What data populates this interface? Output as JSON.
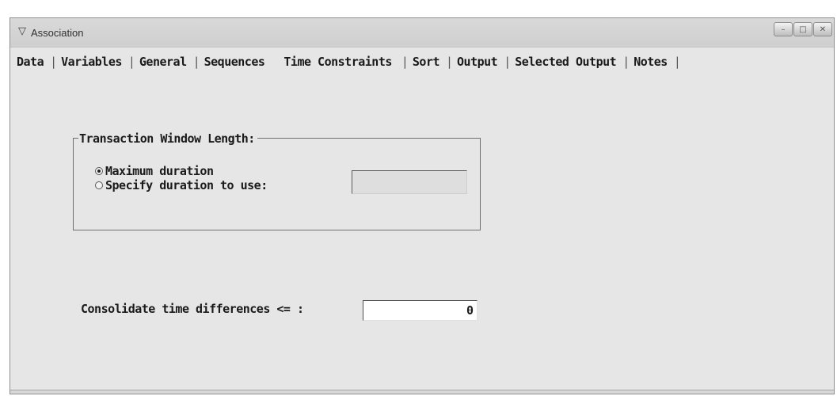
{
  "window": {
    "title": "Association",
    "icon": "sas-v-icon",
    "controls": {
      "minimize": "–",
      "maximize": "□",
      "close": "✕"
    }
  },
  "tabs": [
    {
      "label": "Data"
    },
    {
      "label": "Variables"
    },
    {
      "label": "General"
    },
    {
      "label": "Sequences"
    },
    {
      "label": "Time Constraints",
      "active": true
    },
    {
      "label": "Sort"
    },
    {
      "label": "Output"
    },
    {
      "label": "Selected Output"
    },
    {
      "label": "Notes"
    }
  ],
  "transaction_window": {
    "legend": "Transaction Window Length:",
    "options": [
      {
        "label": "Maximum duration",
        "checked": true
      },
      {
        "label": "Specify duration to use:",
        "checked": false
      }
    ],
    "duration_value": ""
  },
  "consolidate": {
    "label": "Consolidate time differences <= :",
    "value": "0"
  }
}
